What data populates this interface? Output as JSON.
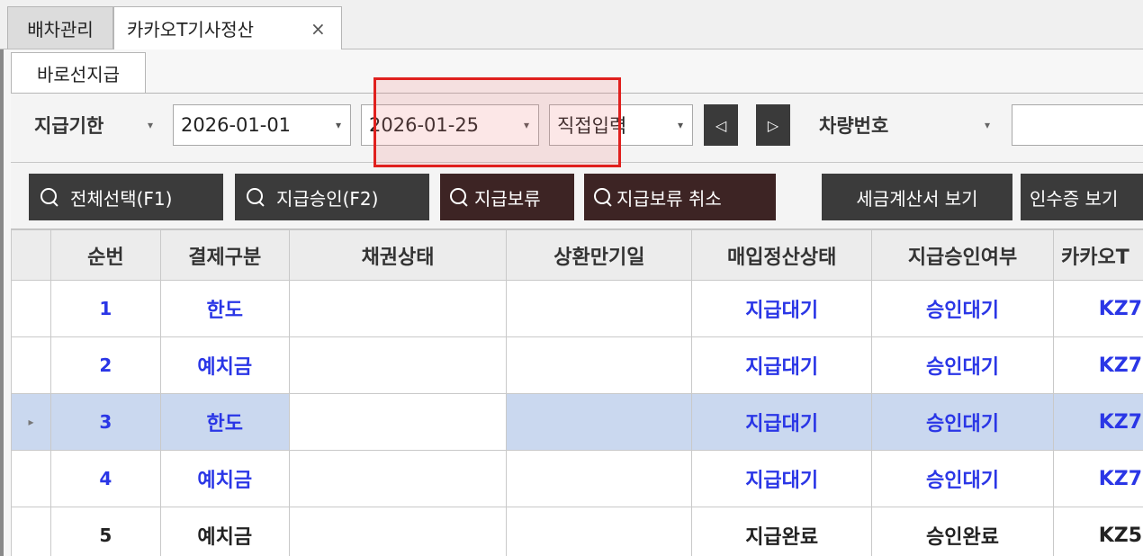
{
  "tabs": [
    {
      "label": "배차관리",
      "active": false
    },
    {
      "label": "카카오T기사정산",
      "active": true,
      "close": "×"
    }
  ],
  "subtab": {
    "label": "바로선지급"
  },
  "filters": {
    "period_label": "지급기한",
    "start_date": "2026-01-01",
    "end_date": "2026-01-25",
    "mode": "직접입력",
    "prev": "◁",
    "next": "▷",
    "vehicle_label": "차량번호",
    "vehicle_value": ""
  },
  "buttons": {
    "select_all": "전체선택(F1)",
    "approve": "지급승인(F2)",
    "hold": "지급보류",
    "hold_cancel": "지급보류 취소",
    "tax_invoice": "세금계산서 보기",
    "receipt": "인수증 보기"
  },
  "grid": {
    "columns": [
      "순번",
      "결제구분",
      "채권상태",
      "상환만기일",
      "매입정산상태",
      "지급승인여부",
      "카카오T"
    ],
    "rows": [
      {
        "no": "1",
        "pay_type": "한도",
        "bond": "",
        "due": "",
        "settle": "지급대기",
        "approval": "승인대기",
        "kakao": "KZ7",
        "done": false
      },
      {
        "no": "2",
        "pay_type": "예치금",
        "bond": "",
        "due": "",
        "settle": "지급대기",
        "approval": "승인대기",
        "kakao": "KZ7",
        "done": false
      },
      {
        "no": "3",
        "pay_type": "한도",
        "bond": "",
        "due": "",
        "settle": "지급대기",
        "approval": "승인대기",
        "kakao": "KZ7",
        "done": false,
        "selected": true
      },
      {
        "no": "4",
        "pay_type": "예치금",
        "bond": "",
        "due": "",
        "settle": "지급대기",
        "approval": "승인대기",
        "kakao": "KZ7",
        "done": false
      },
      {
        "no": "5",
        "pay_type": "예치금",
        "bond": "",
        "due": "",
        "settle": "지급완료",
        "approval": "승인완료",
        "kakao": "KZ5",
        "done": true
      }
    ],
    "row_indicator": "▸"
  },
  "colors": {
    "accent_text": "#2a36e6",
    "selected_row": "#cad8ef",
    "highlight_box": "#e0201e",
    "button_bg": "#3b3b3b"
  }
}
